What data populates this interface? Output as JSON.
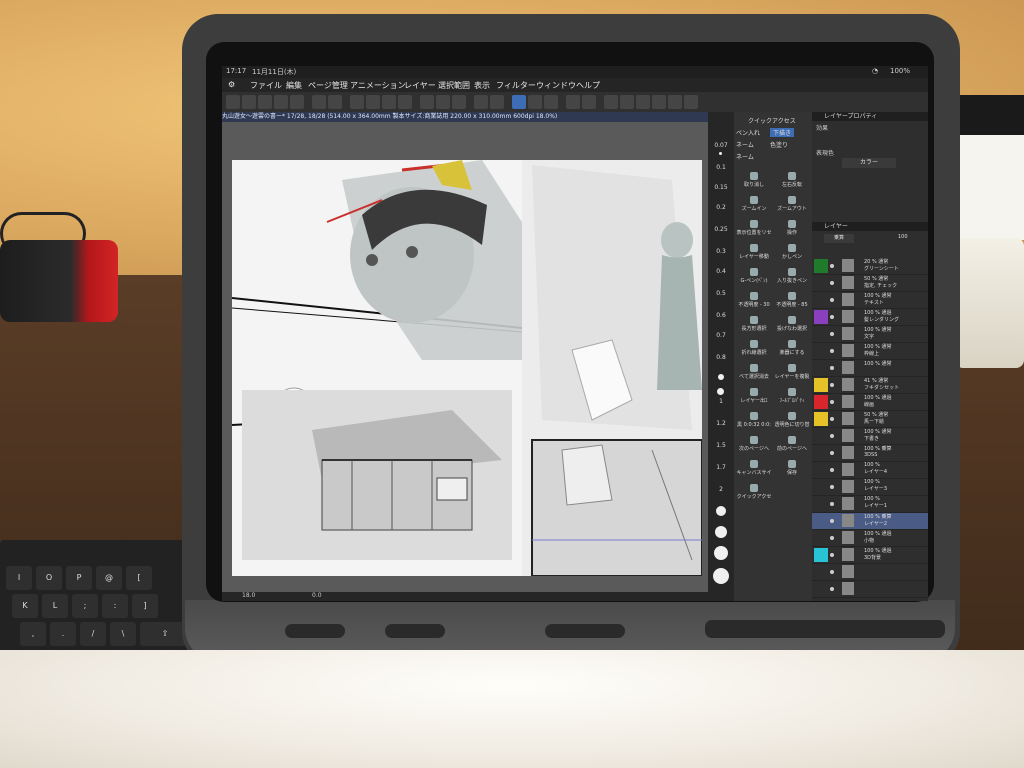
{
  "status_bar": {
    "time": "17:17",
    "date": "11月11日(木)",
    "battery": "100%"
  },
  "menu": [
    "ファイル",
    "編集",
    "ページ管理",
    "アニメーション",
    "レイヤー",
    "選択範囲",
    "表示",
    "フィルター",
    "ウィンドウ",
    "ヘルプ"
  ],
  "document_tab": "丸山遊女～遊雲の書ー* 17/28, 18/28 (514.00 x 364.00mm 製本サイズ:商業誌用 220.00 x 310.00mm 600dpi 18.0%)",
  "canvas": {
    "zoom": "18.0",
    "angle": "0.0"
  },
  "brush_sizes": [
    "0.07",
    "0.1",
    "0.15",
    "0.2",
    "0.25",
    "0.3",
    "0.4",
    "0.5",
    "0.6",
    "0.7",
    "0.8",
    "1",
    "1.2",
    "1.5",
    "1.7",
    "2"
  ],
  "quick_access": {
    "title": "クイックアクセス",
    "tabs": [
      "ペン入れ",
      "下描き",
      "ネーム",
      "色塗り",
      "ネーム"
    ],
    "items": [
      "取り消し",
      "左右反転",
      "ズームイン",
      "ズームアウト",
      "表示位置をリセ",
      "操作",
      "レイヤー移動",
      "かしペン",
      "G-ペン(ﾍﾟﾝ)",
      "入り抜きペン",
      "不透明度 - 30",
      "不透明度 - 85",
      "長方形選択",
      "投げなわ選択",
      "折れ線選択",
      "楽器にする",
      "べて選択消去",
      "レイヤーを複製",
      "レイヤー出ｴ",
      "ﾌｰﾙﾌﾟﾛﾊﾟﾃｨ",
      "黒 0:0:32 0:0:",
      "透明色に切り替",
      "次のページへ",
      "前のページへ",
      "キャンバスサイ",
      "保存",
      "クイックアクセ"
    ]
  },
  "layer_properties": {
    "title": "レイヤープロパティ",
    "effect_label": "効果",
    "expression_label": "表現色",
    "expression_value": "カラー"
  },
  "layer_panel": {
    "title": "レイヤー",
    "blend": "乗算",
    "opacity": "100",
    "layers": [
      {
        "pct": "20 % 通常",
        "name": "グリーンシート",
        "color": "#1f7a2b",
        "selected": false
      },
      {
        "pct": "50 % 通常",
        "name": "指定, チェック",
        "color": "",
        "selected": false
      },
      {
        "pct": "100 % 通常",
        "name": "テキスト",
        "color": "",
        "selected": false
      },
      {
        "pct": "100 % 通過",
        "name": "髪レンダリング",
        "color": "#8a3fbf",
        "selected": false
      },
      {
        "pct": "100 % 通常",
        "name": "文字",
        "color": "",
        "selected": false
      },
      {
        "pct": "100 % 通常",
        "name": "枠線上",
        "color": "",
        "selected": false
      },
      {
        "pct": "100 % 通常",
        "name": "",
        "color": "",
        "selected": false
      },
      {
        "pct": "41 % 通常",
        "name": "フキダシセット",
        "color": "#e6c229",
        "selected": false
      },
      {
        "pct": "100 % 通過",
        "name": "線画",
        "color": "#d9262c",
        "selected": false
      },
      {
        "pct": "50 % 通常",
        "name": "馬ー下絵",
        "color": "#e6c229",
        "selected": false
      },
      {
        "pct": "100 % 通常",
        "name": "下書き",
        "color": "",
        "selected": false
      },
      {
        "pct": "100 % 乗算",
        "name": "3DSS",
        "color": "",
        "selected": false
      },
      {
        "pct": "100 %",
        "name": "レイヤー4",
        "color": "",
        "selected": false
      },
      {
        "pct": "100 %",
        "name": "レイヤー3",
        "color": "",
        "selected": false
      },
      {
        "pct": "100 %",
        "name": "レイヤー1",
        "color": "",
        "selected": false
      },
      {
        "pct": "100 % 乗算",
        "name": "レイヤー2",
        "color": "",
        "selected": true
      },
      {
        "pct": "100 % 通過",
        "name": "小物",
        "color": "",
        "selected": false
      },
      {
        "pct": "100 % 通過",
        "name": "3D背景",
        "color": "#28c4d6",
        "selected": false
      },
      {
        "pct": "",
        "name": "",
        "color": "",
        "selected": false
      },
      {
        "pct": "",
        "name": "",
        "color": "",
        "selected": false
      }
    ]
  }
}
